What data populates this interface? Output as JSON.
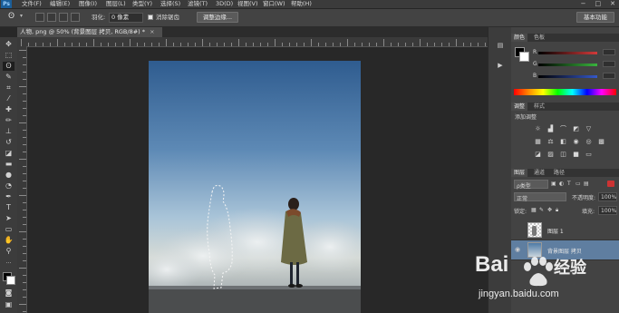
{
  "menubar": {
    "logo": "Ps",
    "items": [
      "文件(F)",
      "编辑(E)",
      "图像(I)",
      "图层(L)",
      "类型(Y)",
      "选择(S)",
      "滤镜(T)",
      "3D(D)",
      "视图(V)",
      "窗口(W)",
      "帮助(H)"
    ],
    "window_controls": [
      "−",
      "□",
      "✕"
    ]
  },
  "options": {
    "feather_label": "羽化:",
    "feather_value": "0 像素",
    "antialias_label": "消除锯齿",
    "refine_edge_button": "调整边缘...",
    "workspace": "基本功能"
  },
  "document": {
    "tab_title": "人物, png @ 50% (背景图层 拷贝, RGB/8#) *",
    "tab_close": "×"
  },
  "color_panel": {
    "tabs": [
      "颜色",
      "色板"
    ],
    "channels": [
      "R",
      "G",
      "B"
    ],
    "colors": {
      "r": "#d23a3a",
      "g": "#39b33d",
      "b": "#3558c9"
    }
  },
  "adjustments_panel": {
    "tabs": [
      "调整",
      "样式"
    ],
    "title": "添加调整"
  },
  "layers_panel": {
    "tabs": [
      "图层",
      "通道",
      "路径"
    ],
    "kind_label": "ρ类型",
    "blend_mode": "正常",
    "opacity_label": "不透明度:",
    "opacity_value": "100%",
    "lock_label": "锁定:",
    "fill_label": "填充:",
    "fill_value": "100%",
    "layers": [
      {
        "name": "图层 1",
        "visible": false,
        "selected": false
      },
      {
        "name": "背景图层 拷贝",
        "visible": true,
        "selected": true
      }
    ]
  },
  "watermark": {
    "brand": "Bai",
    "brand_suffix": "经验",
    "url": "jingyan.baidu.com"
  }
}
